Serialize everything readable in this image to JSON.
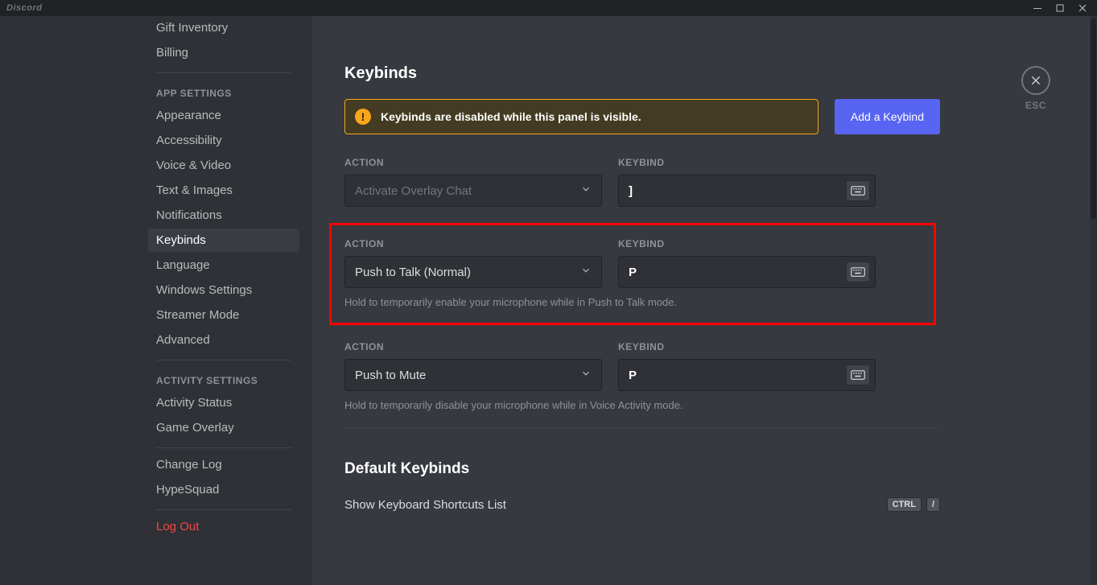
{
  "app": {
    "brand": "Discord"
  },
  "titlebar": {
    "esc_label": "ESC"
  },
  "sidebar": {
    "visible_items_top": [
      {
        "label": "Gift Inventory"
      },
      {
        "label": "Billing"
      }
    ],
    "app_settings_header": "APP SETTINGS",
    "app_settings": [
      {
        "label": "Appearance"
      },
      {
        "label": "Accessibility"
      },
      {
        "label": "Voice & Video"
      },
      {
        "label": "Text & Images"
      },
      {
        "label": "Notifications"
      },
      {
        "label": "Keybinds",
        "active": true
      },
      {
        "label": "Language"
      },
      {
        "label": "Windows Settings"
      },
      {
        "label": "Streamer Mode"
      },
      {
        "label": "Advanced"
      }
    ],
    "activity_header": "ACTIVITY SETTINGS",
    "activity": [
      {
        "label": "Activity Status"
      },
      {
        "label": "Game Overlay"
      }
    ],
    "misc": [
      {
        "label": "Change Log"
      },
      {
        "label": "HypeSquad"
      }
    ],
    "logout": "Log Out"
  },
  "main": {
    "title": "Keybinds",
    "warning": "Keybinds are disabled while this panel is visible.",
    "add_label": "Add a Keybind",
    "labels": {
      "action": "ACTION",
      "keybind": "KEYBIND"
    },
    "entries": [
      {
        "action": "Activate Overlay Chat",
        "key": "]",
        "disabled": true
      },
      {
        "action": "Push to Talk (Normal)",
        "key": "P",
        "desc": "Hold to temporarily enable your microphone while in Push to Talk mode.",
        "highlighted": true
      },
      {
        "action": "Push to Mute",
        "key": "P",
        "desc": "Hold to temporarily disable your microphone while in Voice Activity mode."
      }
    ],
    "default_title": "Default Keybinds",
    "default_item": {
      "label": "Show Keyboard Shortcuts List",
      "keys": [
        "CTRL",
        "/"
      ]
    }
  }
}
